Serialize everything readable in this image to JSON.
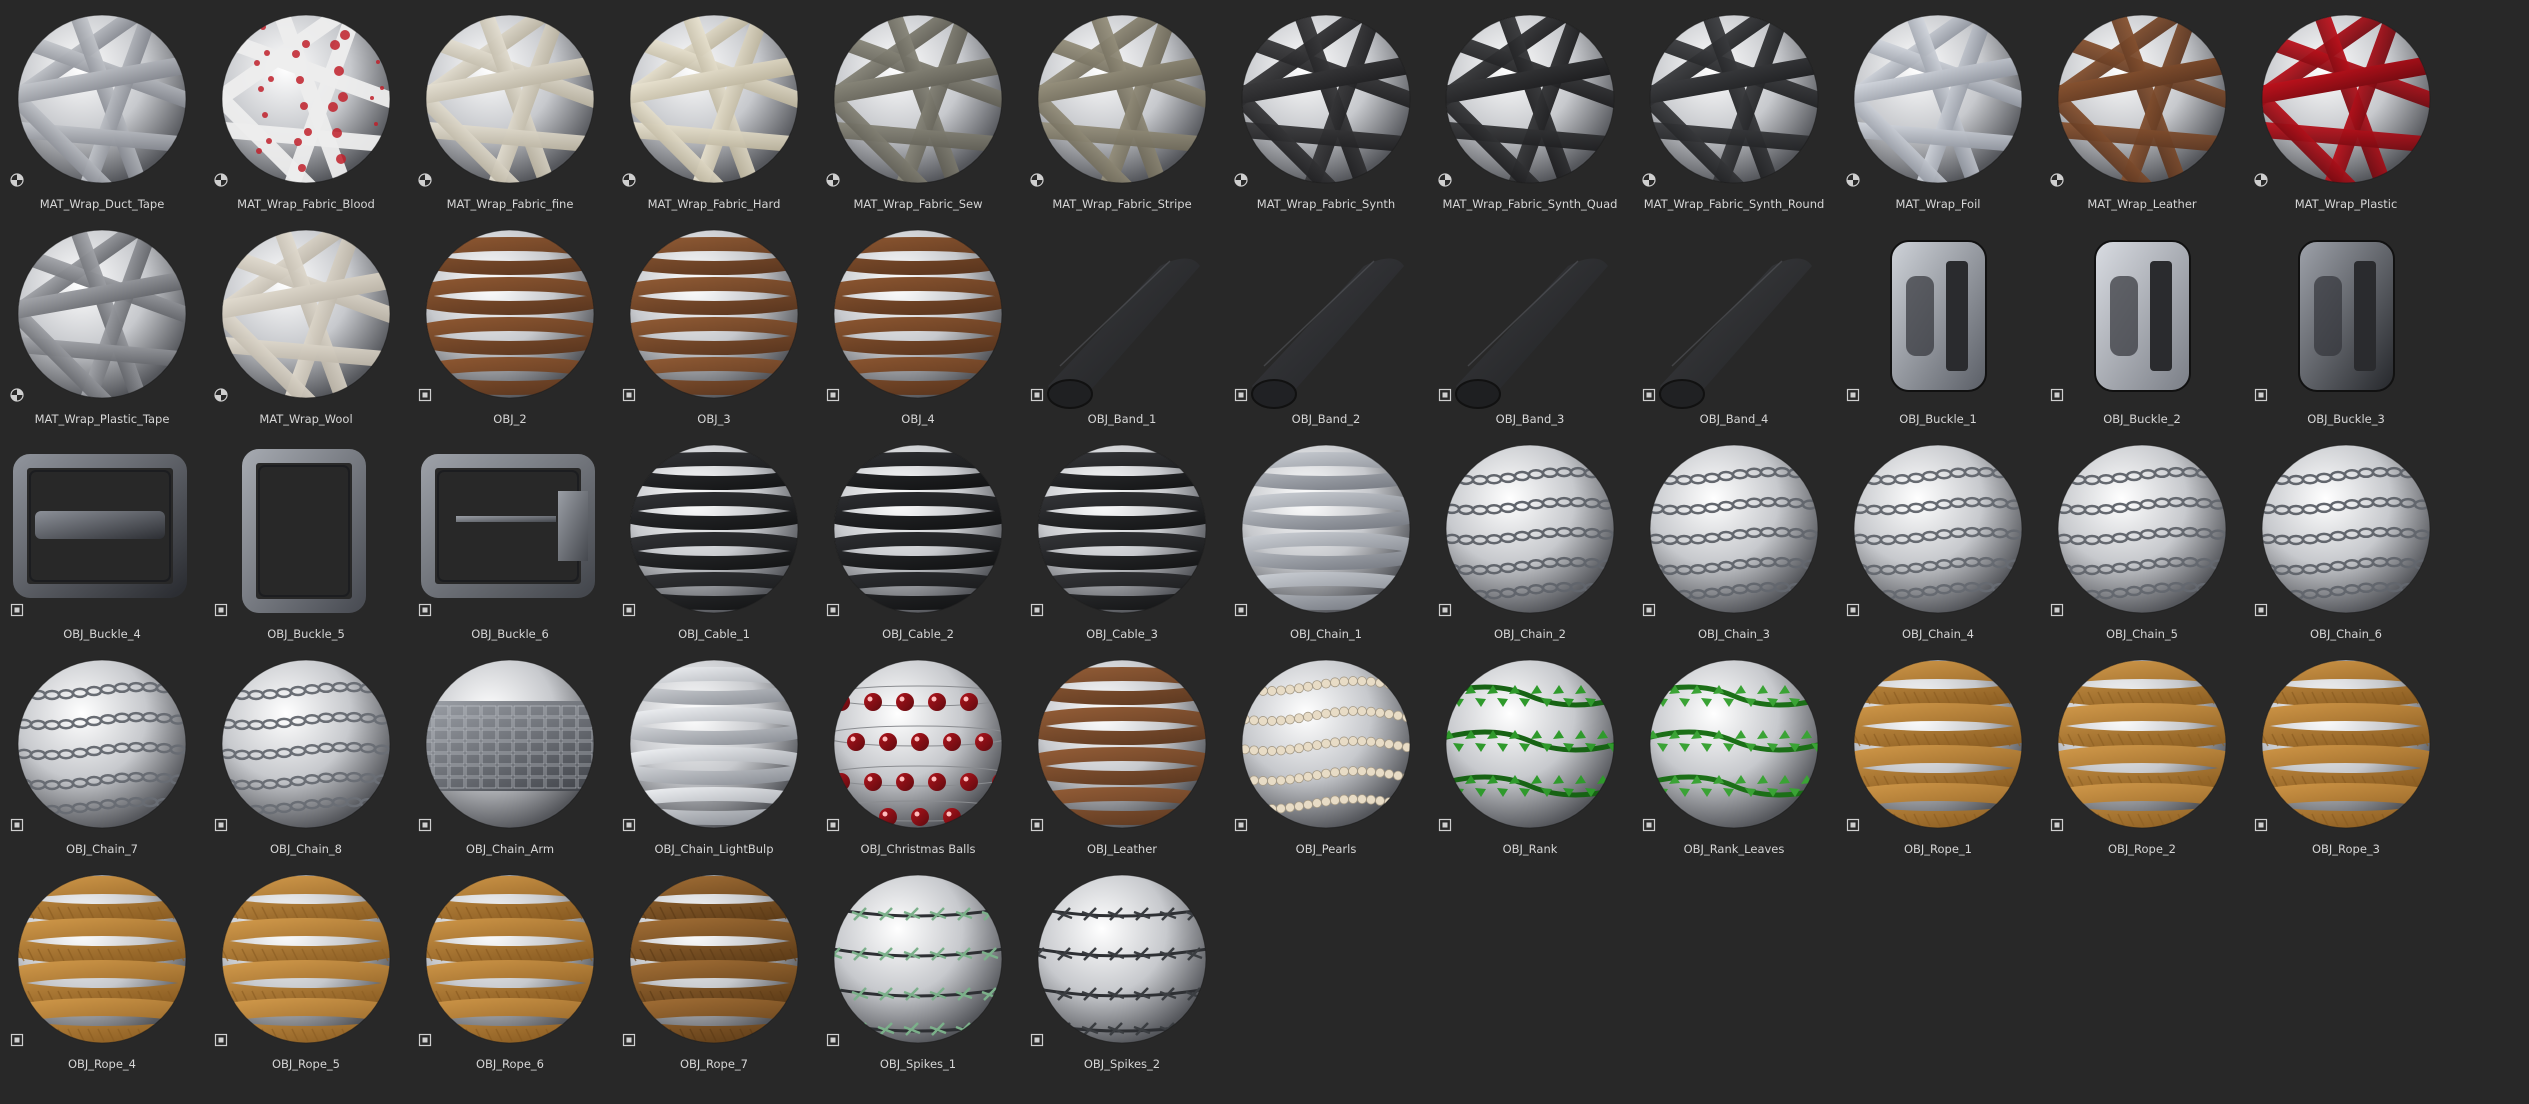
{
  "browser": {
    "background": "#282828",
    "items": [
      {
        "label": "MAT_Wrap_Duct_Tape",
        "kind": "material",
        "look": "wrap",
        "c1": "#c9ccd1",
        "c2": "#7d8088"
      },
      {
        "label": "MAT_Wrap_Fabric_Blood",
        "kind": "material",
        "look": "blood",
        "c1": "#eeeeee",
        "c2": "#c0202a"
      },
      {
        "label": "MAT_Wrap_Fabric_fine",
        "kind": "material",
        "look": "wrap",
        "c1": "#e7e2d5",
        "c2": "#b5ae9c"
      },
      {
        "label": "MAT_Wrap_Fabric_Hard",
        "kind": "material",
        "look": "wrap",
        "c1": "#ece6d4",
        "c2": "#b7af98"
      },
      {
        "label": "MAT_Wrap_Fabric_Sew",
        "kind": "material",
        "look": "wrap",
        "c1": "#8b897c",
        "c2": "#5d5b52"
      },
      {
        "label": "MAT_Wrap_Fabric_Stripe",
        "kind": "material",
        "look": "wrap",
        "c1": "#99937f",
        "c2": "#6b6657"
      },
      {
        "label": "MAT_Wrap_Fabric_Synth",
        "kind": "material",
        "look": "wrap",
        "c1": "#3b3b3d",
        "c2": "#1e1e20"
      },
      {
        "label": "MAT_Wrap_Fabric_Synth_Quad",
        "kind": "material",
        "look": "wrap",
        "c1": "#38393b",
        "c2": "#1b1b1d"
      },
      {
        "label": "MAT_Wrap_Fabric_Synth_Round",
        "kind": "material",
        "look": "wrap",
        "c1": "#3d3e41",
        "c2": "#1f2022"
      },
      {
        "label": "MAT_Wrap_Foil",
        "kind": "material",
        "look": "wrap",
        "c1": "#d7dbe2",
        "c2": "#8a8f99"
      },
      {
        "label": "MAT_Wrap_Leather",
        "kind": "material",
        "look": "wrap",
        "c1": "#8a5431",
        "c2": "#5a3520"
      },
      {
        "label": "MAT_Wrap_Plastic",
        "kind": "material",
        "look": "wrap",
        "c1": "#c4121d",
        "c2": "#6c0a10"
      },
      {
        "label": "MAT_Wrap_Plastic_Tape",
        "kind": "material",
        "look": "wrap",
        "c1": "#a9abb0",
        "c2": "#5d5f64"
      },
      {
        "label": "MAT_Wrap_Wool",
        "kind": "material",
        "look": "wrap",
        "c1": "#e4ded2",
        "c2": "#b8b1a4"
      },
      {
        "label": "OBJ_2",
        "kind": "object",
        "look": "bands",
        "c1": "#8a5530",
        "c2": "#5d3820"
      },
      {
        "label": "OBJ_3",
        "kind": "object",
        "look": "bands",
        "c1": "#8c5833",
        "c2": "#5d3820"
      },
      {
        "label": "OBJ_4",
        "kind": "object",
        "look": "bands",
        "c1": "#87532f",
        "c2": "#5b361e"
      },
      {
        "label": "OBJ_Band_1",
        "kind": "object",
        "look": "strap",
        "c1": "#3a3b3e",
        "c2": "#1f2022"
      },
      {
        "label": "OBJ_Band_2",
        "kind": "object",
        "look": "strap",
        "c1": "#3c3d40",
        "c2": "#202124"
      },
      {
        "label": "OBJ_Band_3",
        "kind": "object",
        "look": "strap",
        "c1": "#3b3c3f",
        "c2": "#1e1f21"
      },
      {
        "label": "OBJ_Band_4",
        "kind": "object",
        "look": "strap",
        "c1": "#3d3e41",
        "c2": "#202123"
      },
      {
        "label": "OBJ_Buckle_1",
        "kind": "object",
        "look": "buckleclip",
        "c1": "#cfd3d9",
        "c2": "#5a5e66"
      },
      {
        "label": "OBJ_Buckle_2",
        "kind": "object",
        "look": "buckleclip",
        "c1": "#d9dce2",
        "c2": "#7a7e86"
      },
      {
        "label": "OBJ_Buckle_3",
        "kind": "object",
        "look": "buckleclip",
        "c1": "#9ea2aa",
        "c2": "#25272b"
      },
      {
        "label": "OBJ_Buckle_4",
        "kind": "object",
        "look": "frame",
        "c1": "#8c9098",
        "c2": "#2c2e33"
      },
      {
        "label": "OBJ_Buckle_5",
        "kind": "object",
        "look": "frametall",
        "c1": "#a2a6ad",
        "c2": "#4b4e55"
      },
      {
        "label": "OBJ_Buckle_6",
        "kind": "object",
        "look": "framebelt",
        "c1": "#9a9ea5",
        "c2": "#45484e"
      },
      {
        "label": "OBJ_Cable_1",
        "kind": "object",
        "look": "bands",
        "c1": "#2f3033",
        "c2": "#151617"
      },
      {
        "label": "OBJ_Cable_2",
        "kind": "object",
        "look": "bands",
        "c1": "#2b2c2f",
        "c2": "#131415"
      },
      {
        "label": "OBJ_Cable_3",
        "kind": "object",
        "look": "bands",
        "c1": "#323336",
        "c2": "#161718"
      },
      {
        "label": "OBJ_Chain_1",
        "kind": "object",
        "look": "bands",
        "c1": "#c5c9cf",
        "c2": "#7b7f87"
      },
      {
        "label": "OBJ_Chain_2",
        "kind": "object",
        "look": "chain",
        "c1": "#b9bdc3",
        "c2": "#61656c"
      },
      {
        "label": "OBJ_Chain_3",
        "kind": "object",
        "look": "chain",
        "c1": "#bcc0c6",
        "c2": "#63676e"
      },
      {
        "label": "OBJ_Chain_4",
        "kind": "object",
        "look": "chain",
        "c1": "#c0c4ca",
        "c2": "#666a71"
      },
      {
        "label": "OBJ_Chain_5",
        "kind": "object",
        "look": "chain",
        "c1": "#bfc3c9",
        "c2": "#64686f"
      },
      {
        "label": "OBJ_Chain_6",
        "kind": "object",
        "look": "chain",
        "c1": "#bdc1c7",
        "c2": "#62666d"
      },
      {
        "label": "OBJ_Chain_7",
        "kind": "object",
        "look": "chain",
        "c1": "#c2c6cc",
        "c2": "#686c73"
      },
      {
        "label": "OBJ_Chain_8",
        "kind": "object",
        "look": "chain",
        "c1": "#c4c8ce",
        "c2": "#6a6e75"
      },
      {
        "label": "OBJ_Chain_Arm",
        "kind": "object",
        "look": "armor",
        "c1": "#9fa3aa",
        "c2": "#3b3e44"
      },
      {
        "label": "OBJ_Chain_LightBulp",
        "kind": "object",
        "look": "bands",
        "c1": "#e9ebee",
        "c2": "#8f939a"
      },
      {
        "label": "OBJ_Christmas Balls",
        "kind": "object",
        "look": "balls",
        "c1": "#b1141c",
        "c2": "#5e0a0f"
      },
      {
        "label": "OBJ_Leather",
        "kind": "object",
        "look": "bands",
        "c1": "#8f5a35",
        "c2": "#603b22"
      },
      {
        "label": "OBJ_Pearls",
        "kind": "object",
        "look": "pearls",
        "c1": "#e8dcc6",
        "c2": "#a59a86"
      },
      {
        "label": "OBJ_Rank",
        "kind": "object",
        "look": "vine",
        "c1": "#2f9a2c",
        "c2": "#176314"
      },
      {
        "label": "OBJ_Rank_Leaves",
        "kind": "object",
        "look": "vine",
        "c1": "#3aa335",
        "c2": "#1b6f17"
      },
      {
        "label": "OBJ_Rope_1",
        "kind": "object",
        "look": "rope",
        "c1": "#c99245",
        "c2": "#8d5f23"
      },
      {
        "label": "OBJ_Rope_2",
        "kind": "object",
        "look": "rope",
        "c1": "#cb9447",
        "c2": "#8f6124"
      },
      {
        "label": "OBJ_Rope_3",
        "kind": "object",
        "look": "rope",
        "c1": "#c89043",
        "c2": "#8b5d22"
      },
      {
        "label": "OBJ_Rope_4",
        "kind": "object",
        "look": "rope",
        "c1": "#ca9346",
        "c2": "#8c5e23"
      },
      {
        "label": "OBJ_Rope_5",
        "kind": "object",
        "look": "rope",
        "c1": "#cc9548",
        "c2": "#8e6025"
      },
      {
        "label": "OBJ_Rope_6",
        "kind": "object",
        "look": "rope",
        "c1": "#c79044",
        "c2": "#8a5c22"
      },
      {
        "label": "OBJ_Rope_7",
        "kind": "object",
        "look": "rope",
        "c1": "#9c6a33",
        "c2": "#5f3d18"
      },
      {
        "label": "OBJ_Spikes_1",
        "kind": "object",
        "look": "spikes",
        "c1": "#7bb08a",
        "c2": "#3a3d41"
      },
      {
        "label": "OBJ_Spikes_2",
        "kind": "object",
        "look": "spikes",
        "c1": "#3a3d41",
        "c2": "#1c1e21"
      }
    ]
  }
}
